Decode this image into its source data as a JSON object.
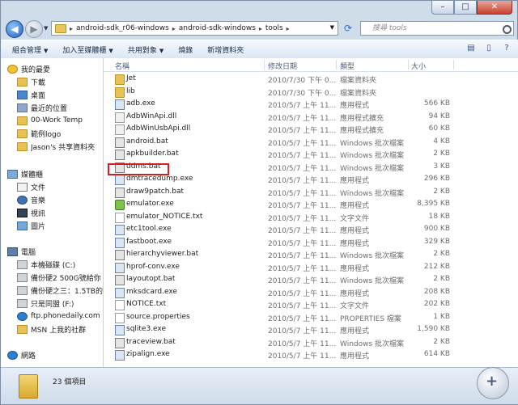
{
  "window": {
    "minimize": "–",
    "maximize": "□",
    "close": "✕"
  },
  "address": {
    "crumbs": [
      "android-sdk_r06-windows",
      "android-sdk-windows",
      "tools"
    ],
    "search_placeholder": "搜尋 tools"
  },
  "toolbar": {
    "items": [
      "組合管理",
      "加入至媒體櫃",
      "共用對象",
      "燒錄",
      "新增資料夾"
    ]
  },
  "nav": {
    "favorites": {
      "title": "我的最愛",
      "items": [
        "下載",
        "桌面",
        "最近的位置",
        "00-Work Temp",
        "範例logo",
        "Jason's 共享資料夾"
      ]
    },
    "libraries": {
      "title": "媒體櫃",
      "items": [
        "文件",
        "音樂",
        "視訊",
        "圖片"
      ]
    },
    "computer": {
      "title": "電腦",
      "items": [
        "本機磁碟 (C:)",
        "備份硬2 500G號給你",
        "備份硬之三：1.5TB的",
        "只是同盟 (F:)",
        "ftp.phonedaily.com",
        "MSN 上我的社群"
      ]
    },
    "network": {
      "title": "網路"
    }
  },
  "columns": {
    "name": "名稱",
    "date": "修改日期",
    "type": "類型",
    "size": "大小"
  },
  "files": [
    {
      "name": "Jet",
      "date": "2010/7/30 下午 0...",
      "type": "檔案資料夾",
      "size": "",
      "icon": "folder"
    },
    {
      "name": "lib",
      "date": "2010/7/30 下午 0...",
      "type": "檔案資料夾",
      "size": "",
      "icon": "folder"
    },
    {
      "name": "adb.exe",
      "date": "2010/5/7 上午 11...",
      "type": "應用程式",
      "size": "566 KB",
      "icon": "exe"
    },
    {
      "name": "AdbWinApi.dll",
      "date": "2010/5/7 上午 11...",
      "type": "應用程式擴充",
      "size": "94 KB",
      "icon": "dll"
    },
    {
      "name": "AdbWinUsbApi.dll",
      "date": "2010/5/7 上午 11...",
      "type": "應用程式擴充",
      "size": "60 KB",
      "icon": "dll"
    },
    {
      "name": "android.bat",
      "date": "2010/5/7 上午 11...",
      "type": "Windows 批次檔案",
      "size": "4 KB",
      "icon": "bat"
    },
    {
      "name": "apkbuilder.bat",
      "date": "2010/5/7 上午 11...",
      "type": "Windows 批次檔案",
      "size": "2 KB",
      "icon": "bat"
    },
    {
      "name": "ddms.bat",
      "date": "2010/5/7 上午 11...",
      "type": "Windows 批次檔案",
      "size": "3 KB",
      "icon": "bat"
    },
    {
      "name": "dmtracedump.exe",
      "date": "2010/5/7 上午 11...",
      "type": "應用程式",
      "size": "296 KB",
      "icon": "exe"
    },
    {
      "name": "draw9patch.bat",
      "date": "2010/5/7 上午 11...",
      "type": "Windows 批次檔案",
      "size": "2 KB",
      "icon": "bat"
    },
    {
      "name": "emulator.exe",
      "date": "2010/5/7 上午 11...",
      "type": "應用程式",
      "size": "8,395 KB",
      "icon": "green"
    },
    {
      "name": "emulator_NOTICE.txt",
      "date": "2010/5/7 上午 11...",
      "type": "文字文件",
      "size": "18 KB",
      "icon": "txt"
    },
    {
      "name": "etc1tool.exe",
      "date": "2010/5/7 上午 11...",
      "type": "應用程式",
      "size": "900 KB",
      "icon": "exe"
    },
    {
      "name": "fastboot.exe",
      "date": "2010/5/7 上午 11...",
      "type": "應用程式",
      "size": "329 KB",
      "icon": "exe"
    },
    {
      "name": "hierarchyviewer.bat",
      "date": "2010/5/7 上午 11...",
      "type": "Windows 批次檔案",
      "size": "2 KB",
      "icon": "bat"
    },
    {
      "name": "hprof-conv.exe",
      "date": "2010/5/7 上午 11...",
      "type": "應用程式",
      "size": "212 KB",
      "icon": "exe"
    },
    {
      "name": "layoutopt.bat",
      "date": "2010/5/7 上午 11...",
      "type": "Windows 批次檔案",
      "size": "2 KB",
      "icon": "bat"
    },
    {
      "name": "mksdcard.exe",
      "date": "2010/5/7 上午 11...",
      "type": "應用程式",
      "size": "208 KB",
      "icon": "exe"
    },
    {
      "name": "NOTICE.txt",
      "date": "2010/5/7 上午 11...",
      "type": "文字文件",
      "size": "202 KB",
      "icon": "txt"
    },
    {
      "name": "source.properties",
      "date": "2010/5/7 上午 11...",
      "type": "PROPERTIES 檔案",
      "size": "1 KB",
      "icon": "txt"
    },
    {
      "name": "sqlite3.exe",
      "date": "2010/5/7 上午 11...",
      "type": "應用程式",
      "size": "1,590 KB",
      "icon": "exe"
    },
    {
      "name": "traceview.bat",
      "date": "2010/5/7 上午 11...",
      "type": "Windows 批次檔案",
      "size": "2 KB",
      "icon": "bat"
    },
    {
      "name": "zipalign.exe",
      "date": "2010/5/7 上午 11...",
      "type": "應用程式",
      "size": "614 KB",
      "icon": "exe"
    }
  ],
  "status": {
    "count": "23 個項目"
  },
  "zoom": {
    "plus": "+"
  }
}
